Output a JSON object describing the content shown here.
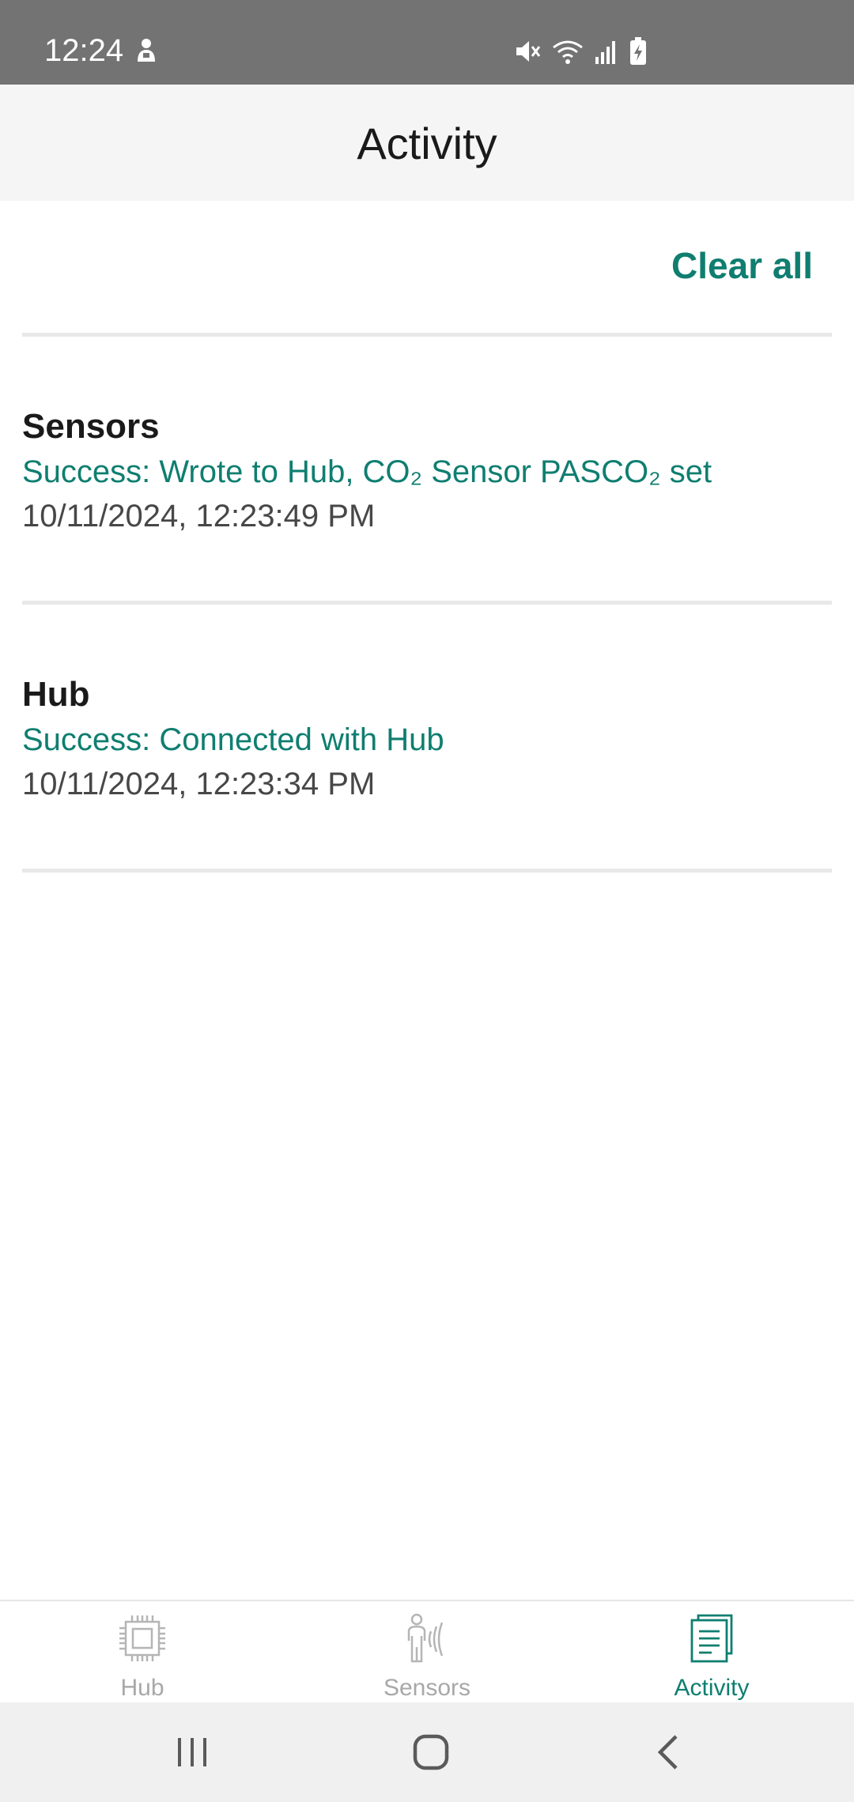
{
  "status_bar": {
    "time": "12:24",
    "icons": [
      "person-icon",
      "mute-icon",
      "wifi-icon",
      "signal-icon",
      "battery-charging-icon"
    ]
  },
  "header": {
    "title": "Activity"
  },
  "actions": {
    "clear_all": "Clear all"
  },
  "activity": [
    {
      "title": "Sensors",
      "message": "Success: Wrote to Hub, CO₂ Sensor PASCO₂ set",
      "timestamp": "10/11/2024, 12:23:49 PM"
    },
    {
      "title": "Hub",
      "message": "Success: Connected with Hub",
      "timestamp": "10/11/2024, 12:23:34 PM"
    }
  ],
  "bottom_nav": {
    "items": [
      {
        "label": "Hub",
        "icon": "chip-icon",
        "active": false
      },
      {
        "label": "Sensors",
        "icon": "sensor-person-icon",
        "active": false
      },
      {
        "label": "Activity",
        "icon": "document-list-icon",
        "active": true
      }
    ]
  },
  "system_nav": {
    "buttons": [
      "recents-icon",
      "home-icon",
      "back-icon"
    ]
  },
  "colors": {
    "accent": "#0f7e70",
    "status_bar": "#737373",
    "header_bg": "#f5f5f5",
    "inactive": "#a8a8a8"
  }
}
